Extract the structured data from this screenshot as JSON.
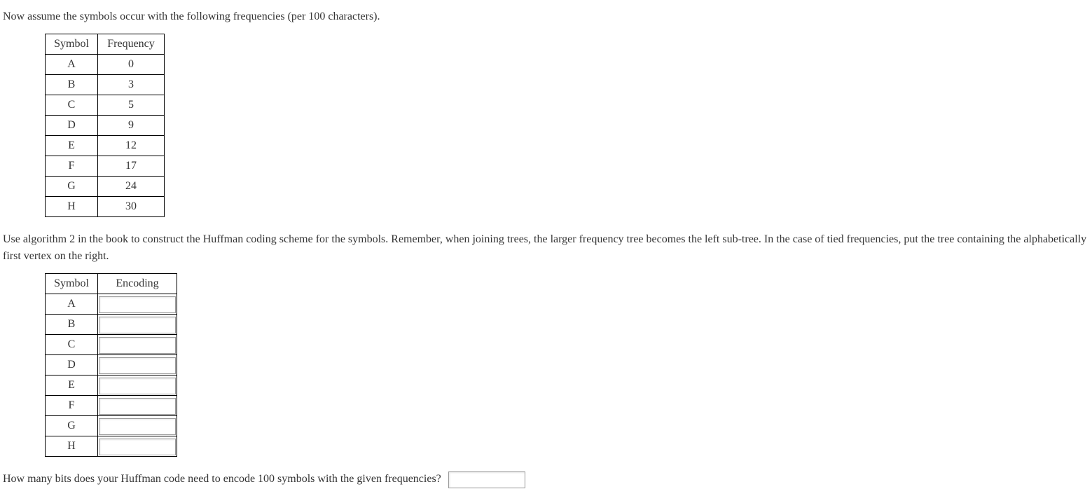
{
  "intro": "Now assume the symbols occur with the following frequencies (per 100 characters).",
  "freqTable": {
    "headers": {
      "symbol": "Symbol",
      "frequency": "Frequency"
    },
    "rows": [
      {
        "symbol": "A",
        "frequency": "0"
      },
      {
        "symbol": "B",
        "frequency": "3"
      },
      {
        "symbol": "C",
        "frequency": "5"
      },
      {
        "symbol": "D",
        "frequency": "9"
      },
      {
        "symbol": "E",
        "frequency": "12"
      },
      {
        "symbol": "F",
        "frequency": "17"
      },
      {
        "symbol": "G",
        "frequency": "24"
      },
      {
        "symbol": "H",
        "frequency": "30"
      }
    ]
  },
  "instructions": "Use algorithm 2 in the book to construct the Huffman coding scheme for the symbols. Remember, when joining trees, the larger frequency tree becomes the left sub-tree. In the case of tied frequencies, put the tree containing the alphabetically first vertex on the right.",
  "encodingTable": {
    "headers": {
      "symbol": "Symbol",
      "encoding": "Encoding"
    },
    "rows": [
      {
        "symbol": "A",
        "encoding": ""
      },
      {
        "symbol": "B",
        "encoding": ""
      },
      {
        "symbol": "C",
        "encoding": ""
      },
      {
        "symbol": "D",
        "encoding": ""
      },
      {
        "symbol": "E",
        "encoding": ""
      },
      {
        "symbol": "F",
        "encoding": ""
      },
      {
        "symbol": "G",
        "encoding": ""
      },
      {
        "symbol": "H",
        "encoding": ""
      }
    ]
  },
  "finalQuestion": "How many bits does your Huffman code need to encode 100 symbols with the given frequencies?",
  "finalAnswer": ""
}
